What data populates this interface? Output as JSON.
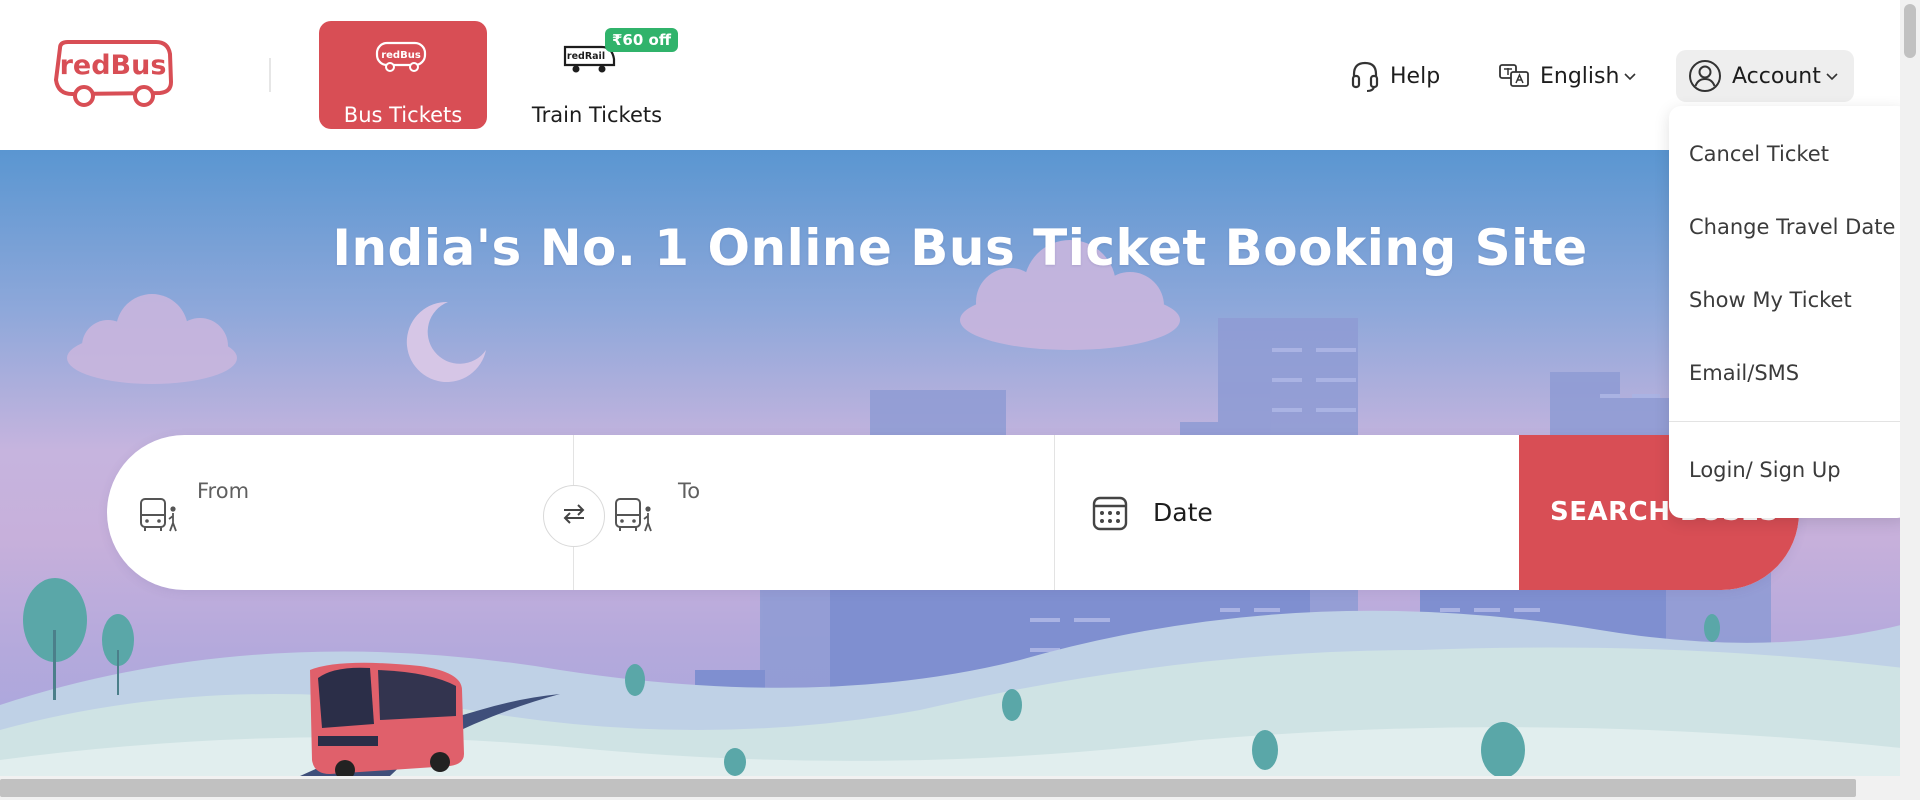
{
  "brand": {
    "logo_text": "redBus",
    "accent": "#d84e55",
    "offer_green": "#30b36b"
  },
  "tabs": [
    {
      "label": "Bus Tickets",
      "icon": "redbus-bus-icon",
      "active": true
    },
    {
      "label": "Train Tickets",
      "icon": "redrail-train-icon",
      "badge": "₹60 off",
      "active": false
    }
  ],
  "tab_icons": {
    "bus_mini_logo": "redBus",
    "train_mini_logo": "redRail"
  },
  "nav": {
    "help": "Help",
    "language": "English",
    "account": "Account"
  },
  "hero": {
    "title": "India's No. 1 Online Bus Ticket Booking Site"
  },
  "search": {
    "from_label": "From",
    "to_label": "To",
    "date_label": "Date",
    "button_label": "SEARCH BUSES"
  },
  "account_menu": {
    "items": [
      "Cancel Ticket",
      "Change Travel Date",
      "Show My Ticket",
      "Email/SMS"
    ],
    "login": "Login/ Sign Up"
  }
}
